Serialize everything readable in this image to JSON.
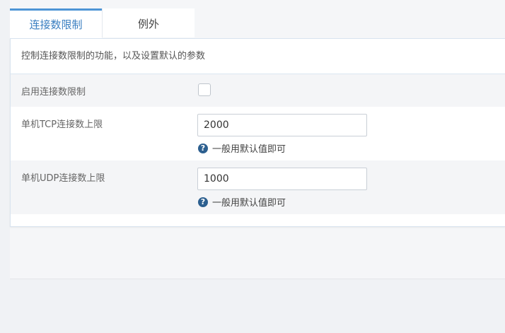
{
  "tabs": [
    {
      "label": "连接数限制",
      "active": true
    },
    {
      "label": "例外",
      "active": false
    }
  ],
  "panel": {
    "description": "控制连接数限制的功能，以及设置默认的参数"
  },
  "settings": {
    "enable": {
      "label": "启用连接数限制",
      "checked": false
    },
    "tcp": {
      "label": "单机TCP连接数上限",
      "value": "2000",
      "help": "一般用默认值即可"
    },
    "udp": {
      "label": "单机UDP连接数上限",
      "value": "1000",
      "help": "一般用默认值即可"
    }
  },
  "icons": {
    "help": "question-circle-icon"
  },
  "colors": {
    "accent": "#4e95d6",
    "active_tab_text": "#3a7fc1",
    "help_icon": "#2c5f8f"
  }
}
